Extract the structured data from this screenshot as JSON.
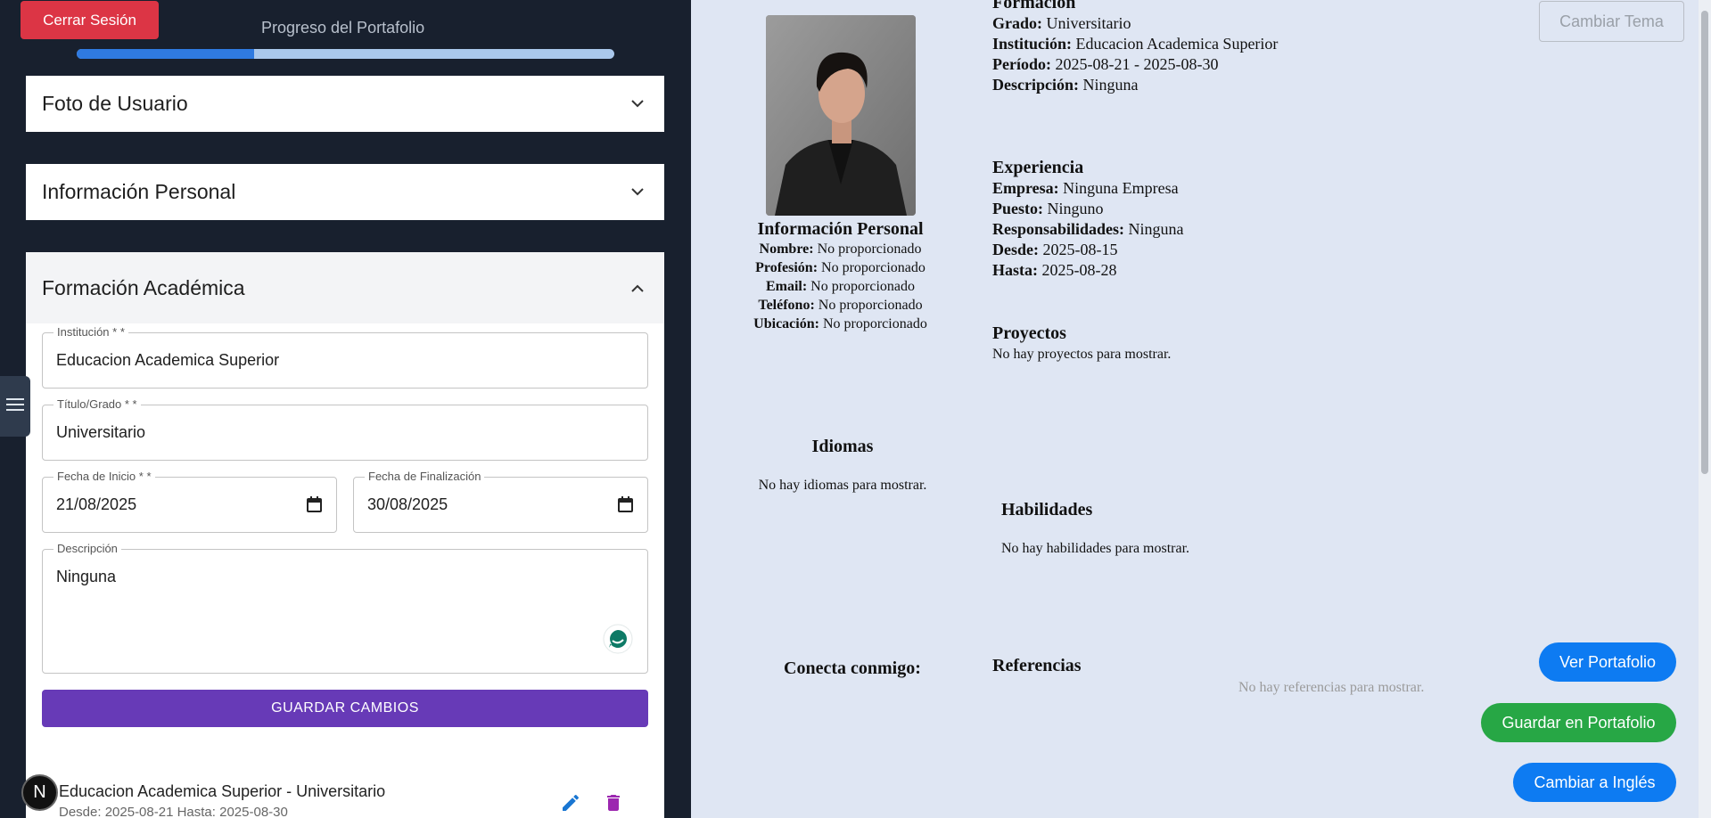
{
  "left": {
    "logout_label": "Cerrar Sesión",
    "progress_label": "Progreso del Portafolio",
    "progress_value": 0.33,
    "sections": {
      "photo": "Foto de Usuario",
      "personal": "Información Personal",
      "academic": "Formación Académica"
    },
    "form": {
      "institution_label": "Institución * *",
      "institution_value": "Educacion Academica Superior",
      "title_label": "Título/Grado * *",
      "title_value": "Universitario",
      "start_label": "Fecha de Inicio * *",
      "start_value": "21/08/2025",
      "end_label": "Fecha de Finalización",
      "end_value": "30/08/2025",
      "description_label": "Descripción",
      "description_value": "Ninguna",
      "save_label": "GUARDAR CAMBIOS"
    },
    "entry": {
      "title": "Educacion Academica Superior - Universitario",
      "dates": "Desde: 2025-08-21 Hasta: 2025-08-30"
    },
    "badge_letter": "N"
  },
  "right": {
    "theme_button": "Cambiar Tema",
    "personal": {
      "heading": "Información Personal",
      "name_k": "Nombre:",
      "name_v": "No proporcionado",
      "profession_k": "Profesión:",
      "profession_v": "No proporcionado",
      "email_k": "Email:",
      "email_v": "No proporcionado",
      "phone_k": "Teléfono:",
      "phone_v": "No proporcionado",
      "location_k": "Ubicación:",
      "location_v": "No proporcionado"
    },
    "formation": {
      "heading": "Formación",
      "grade_k": "Grado:",
      "grade_v": "Universitario",
      "inst_k": "Institución:",
      "inst_v": "Educacion Academica Superior",
      "period_k": "Período:",
      "period_v": "2025-08-21 - 2025-08-30",
      "desc_k": "Descripción:",
      "desc_v": "Ninguna"
    },
    "experience": {
      "heading": "Experiencia",
      "company_k": "Empresa:",
      "company_v": "Ninguna Empresa",
      "role_k": "Puesto:",
      "role_v": "Ninguno",
      "resp_k": "Responsabilidades:",
      "resp_v": "Ninguna",
      "from_k": "Desde:",
      "from_v": "2025-08-15",
      "to_k": "Hasta:",
      "to_v": "2025-08-28"
    },
    "projects": {
      "heading": "Proyectos",
      "empty": "No hay proyectos para mostrar."
    },
    "languages": {
      "heading": "Idiomas",
      "empty": "No hay idiomas para mostrar."
    },
    "skills": {
      "heading": "Habilidades",
      "empty": "No hay habilidades para mostrar."
    },
    "connect": {
      "heading": "Conecta conmigo:"
    },
    "references": {
      "heading": "Referencias",
      "empty": "No hay referencias para mostrar."
    },
    "buttons": {
      "view": "Ver Portafolio",
      "save": "Guardar en Portafolio",
      "english": "Cambiar a Inglés"
    }
  },
  "colors": {
    "sidebar_bg": "#18202e",
    "logout": "#dc3545",
    "primary_purple": "#673ab7",
    "fab_blue": "#0d7bf2",
    "fab_green": "#27a745",
    "preview_bg": "#dfe6f3"
  },
  "icons": [
    "chevron-down-icon",
    "chevron-up-icon",
    "calendar-icon",
    "edit-icon",
    "delete-icon",
    "menu-icon",
    "assistant-icon"
  ]
}
